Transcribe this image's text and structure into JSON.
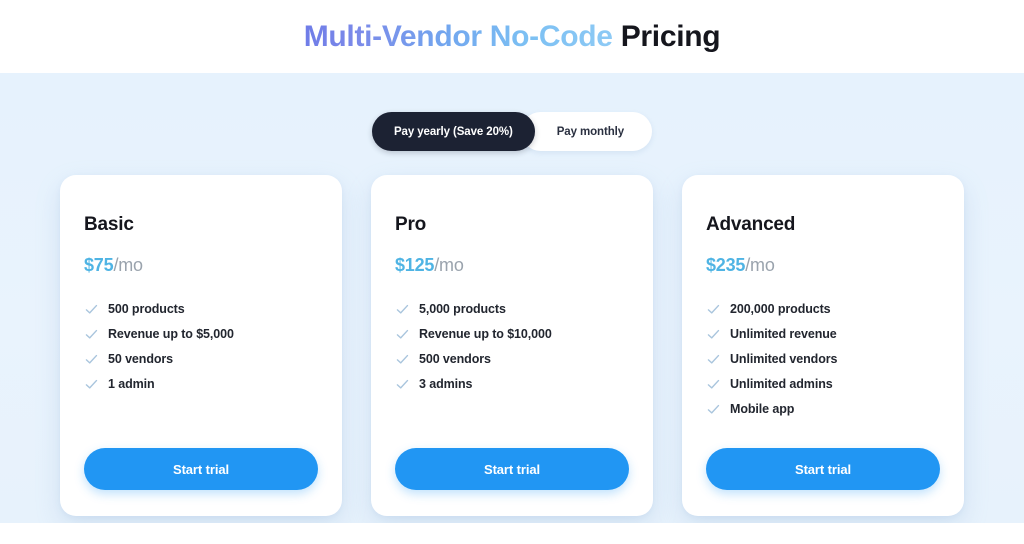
{
  "header": {
    "title_gradient": "Multi-Vendor No-Code",
    "title_dark": "Pricing",
    "title_full": "Multi-Vendor No-Code Pricing"
  },
  "billing_toggle": {
    "yearly_label": "Pay yearly (Save 20%)",
    "monthly_label": "Pay monthly",
    "selected": "yearly"
  },
  "plans": [
    {
      "name": "Basic",
      "price": "$75",
      "period": "/mo",
      "features": [
        "500 products",
        "Revenue up to $5,000",
        "50 vendors",
        "1 admin"
      ],
      "cta_label": "Start trial"
    },
    {
      "name": "Pro",
      "price": "$125",
      "period": "/mo",
      "features": [
        "5,000 products",
        "Revenue up to $10,000",
        "500 vendors",
        "3 admins"
      ],
      "cta_label": "Start trial"
    },
    {
      "name": "Advanced",
      "price": "$235",
      "period": "/mo",
      "features": [
        "200,000 products",
        "Unlimited revenue",
        "Unlimited vendors",
        "Unlimited admins",
        "Mobile app"
      ],
      "cta_label": "Start trial"
    }
  ],
  "colors": {
    "accent_blue": "#2196f3",
    "price_blue": "#4fb4e4",
    "toggle_dark": "#1c2233",
    "background_tint": "#e8f3fd",
    "check_icon": "#a9c5dd",
    "title_gradient_start": "#6f7ce8",
    "title_gradient_end": "#8ecaf5",
    "heading_dark": "#15161d"
  },
  "icons": {
    "check": "check-icon"
  }
}
